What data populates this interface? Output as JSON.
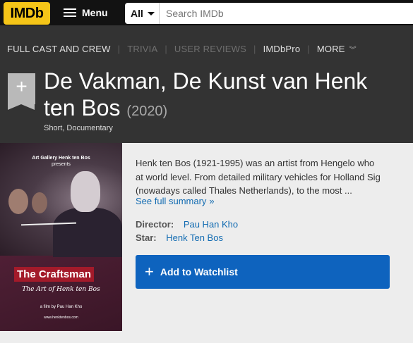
{
  "header": {
    "logo_text": "IMDb",
    "menu_label": "Menu",
    "search_category": "All",
    "search_placeholder": "Search IMDb"
  },
  "subnav": {
    "links": [
      {
        "label": "FULL CAST AND CREW"
      },
      {
        "label": "TRIVIA"
      },
      {
        "label": "USER REVIEWS"
      },
      {
        "label": "IMDbPro"
      },
      {
        "label": "MORE"
      }
    ]
  },
  "title_block": {
    "add_symbol": "+",
    "title_line1": "De Vakman, De Kunst van Henk",
    "title_line2": "ten Bos",
    "year": "(2020)",
    "genres": "Short, Documentary"
  },
  "poster": {
    "credit_line1": "Art Gallery Henk ten Bos",
    "credit_line2": "presents",
    "title": "The Craftsman",
    "subtitle": "The Art of Henk ten Bos",
    "film_by": "a film by Pau Han Kho",
    "url": "www.henktenbos.com"
  },
  "summary": {
    "line1": "Henk ten Bos (1921-1995) was an artist from Hengelo who",
    "line2": "at world level. From detailed military vehicles for Holland Sig",
    "line3": "(nowadays called Thales Netherlands), to the most ...",
    "see_full": "See full summary",
    "see_full_arrow": "»"
  },
  "credits": {
    "director_label": "Director:",
    "director_value": "Pau Han Kho",
    "star_label": "Star:",
    "star_value": "Henk Ten Bos"
  },
  "watchlist": {
    "icon": "+",
    "label": "Add to Watchlist"
  },
  "colors": {
    "imdb_yellow": "#f5c518",
    "link_blue": "#136cb2",
    "button_blue": "#0e63be"
  }
}
